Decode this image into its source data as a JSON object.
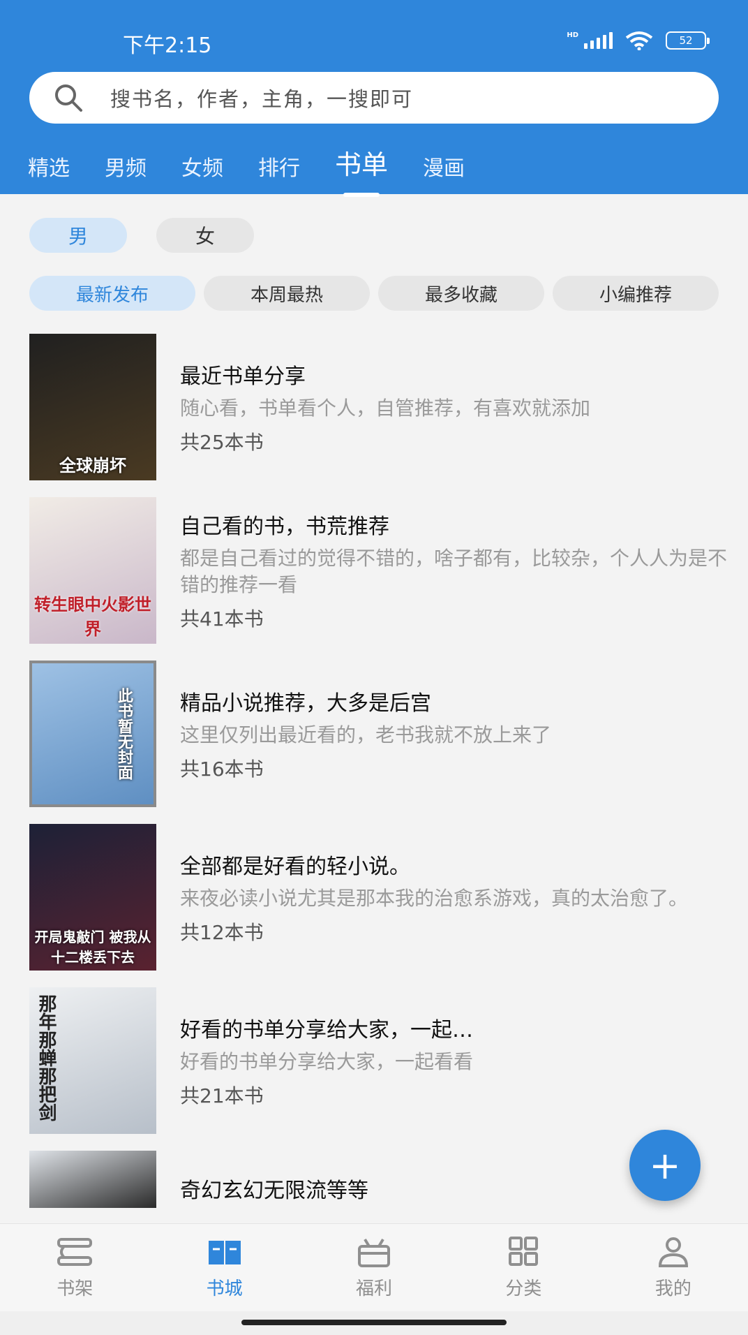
{
  "status": {
    "time": "下午2:15",
    "battery": "52",
    "hd": "HD"
  },
  "search": {
    "placeholder": "搜书名，作者，主角，一搜即可"
  },
  "tabs": [
    {
      "label": "精选"
    },
    {
      "label": "男频"
    },
    {
      "label": "女频"
    },
    {
      "label": "排行"
    },
    {
      "label": "书单",
      "active": true
    },
    {
      "label": "漫画"
    }
  ],
  "gender_filters": [
    {
      "label": "男",
      "active": true
    },
    {
      "label": "女"
    }
  ],
  "sort_filters": [
    {
      "label": "最新发布",
      "active": true
    },
    {
      "label": "本周最热"
    },
    {
      "label": "最多收藏"
    },
    {
      "label": "小编推荐"
    }
  ],
  "booklists": [
    {
      "title": "最近书单分享",
      "desc": "随心看，书单看个人，自管推荐，有喜欢就添加",
      "count": "共25本书",
      "cover_text": "全球崩坏",
      "cover_colors": [
        "#202020",
        "#4a3a22"
      ]
    },
    {
      "title": "自己看的书，书荒推荐",
      "desc": "都是自己看过的觉得不错的，啥子都有，比较杂，个人人为是不错的推荐一看",
      "count": "共41本书",
      "cover_text": "转生眼中火影世界",
      "cover_colors": [
        "#f1ece6",
        "#c9b7c9"
      ]
    },
    {
      "title": "精品小说推荐，大多是后宫",
      "desc": "这里仅列出最近看的，老书我就不放上来了",
      "count": "共16本书",
      "cover_text": "此书暂无封面",
      "cover_colors": [
        "#9ec1e4",
        "#5f8fc2"
      ]
    },
    {
      "title": "全部都是好看的轻小说。",
      "desc": "来夜必读小说尤其是那本我的治愈系游戏，真的太治愈了。",
      "count": "共12本书",
      "cover_text": "开局鬼敲门 被我从十二楼丢下去",
      "cover_colors": [
        "#1d2137",
        "#5a2230"
      ]
    },
    {
      "title": "好看的书单分享给大家，一起…",
      "desc": "好看的书单分享给大家，一起看看",
      "count": "共21本书",
      "cover_text": "那年那蝉那把剑",
      "cover_colors": [
        "#eef0f2",
        "#b7bfc9"
      ]
    },
    {
      "title": "奇幻玄幻无限流等等",
      "desc": "",
      "count": "",
      "cover_text": "",
      "cover_colors": [
        "#dfe3e8",
        "#2a2a2a"
      ]
    }
  ],
  "fab": {
    "label": "+"
  },
  "bottom_nav": [
    {
      "label": "书架",
      "icon": "bookshelf-icon"
    },
    {
      "label": "书城",
      "icon": "bookstore-icon",
      "active": true
    },
    {
      "label": "福利",
      "icon": "gift-icon"
    },
    {
      "label": "分类",
      "icon": "category-grid-icon"
    },
    {
      "label": "我的",
      "icon": "profile-icon"
    }
  ],
  "colors": {
    "accent": "#2f86db",
    "background": "#f3f3f3"
  }
}
